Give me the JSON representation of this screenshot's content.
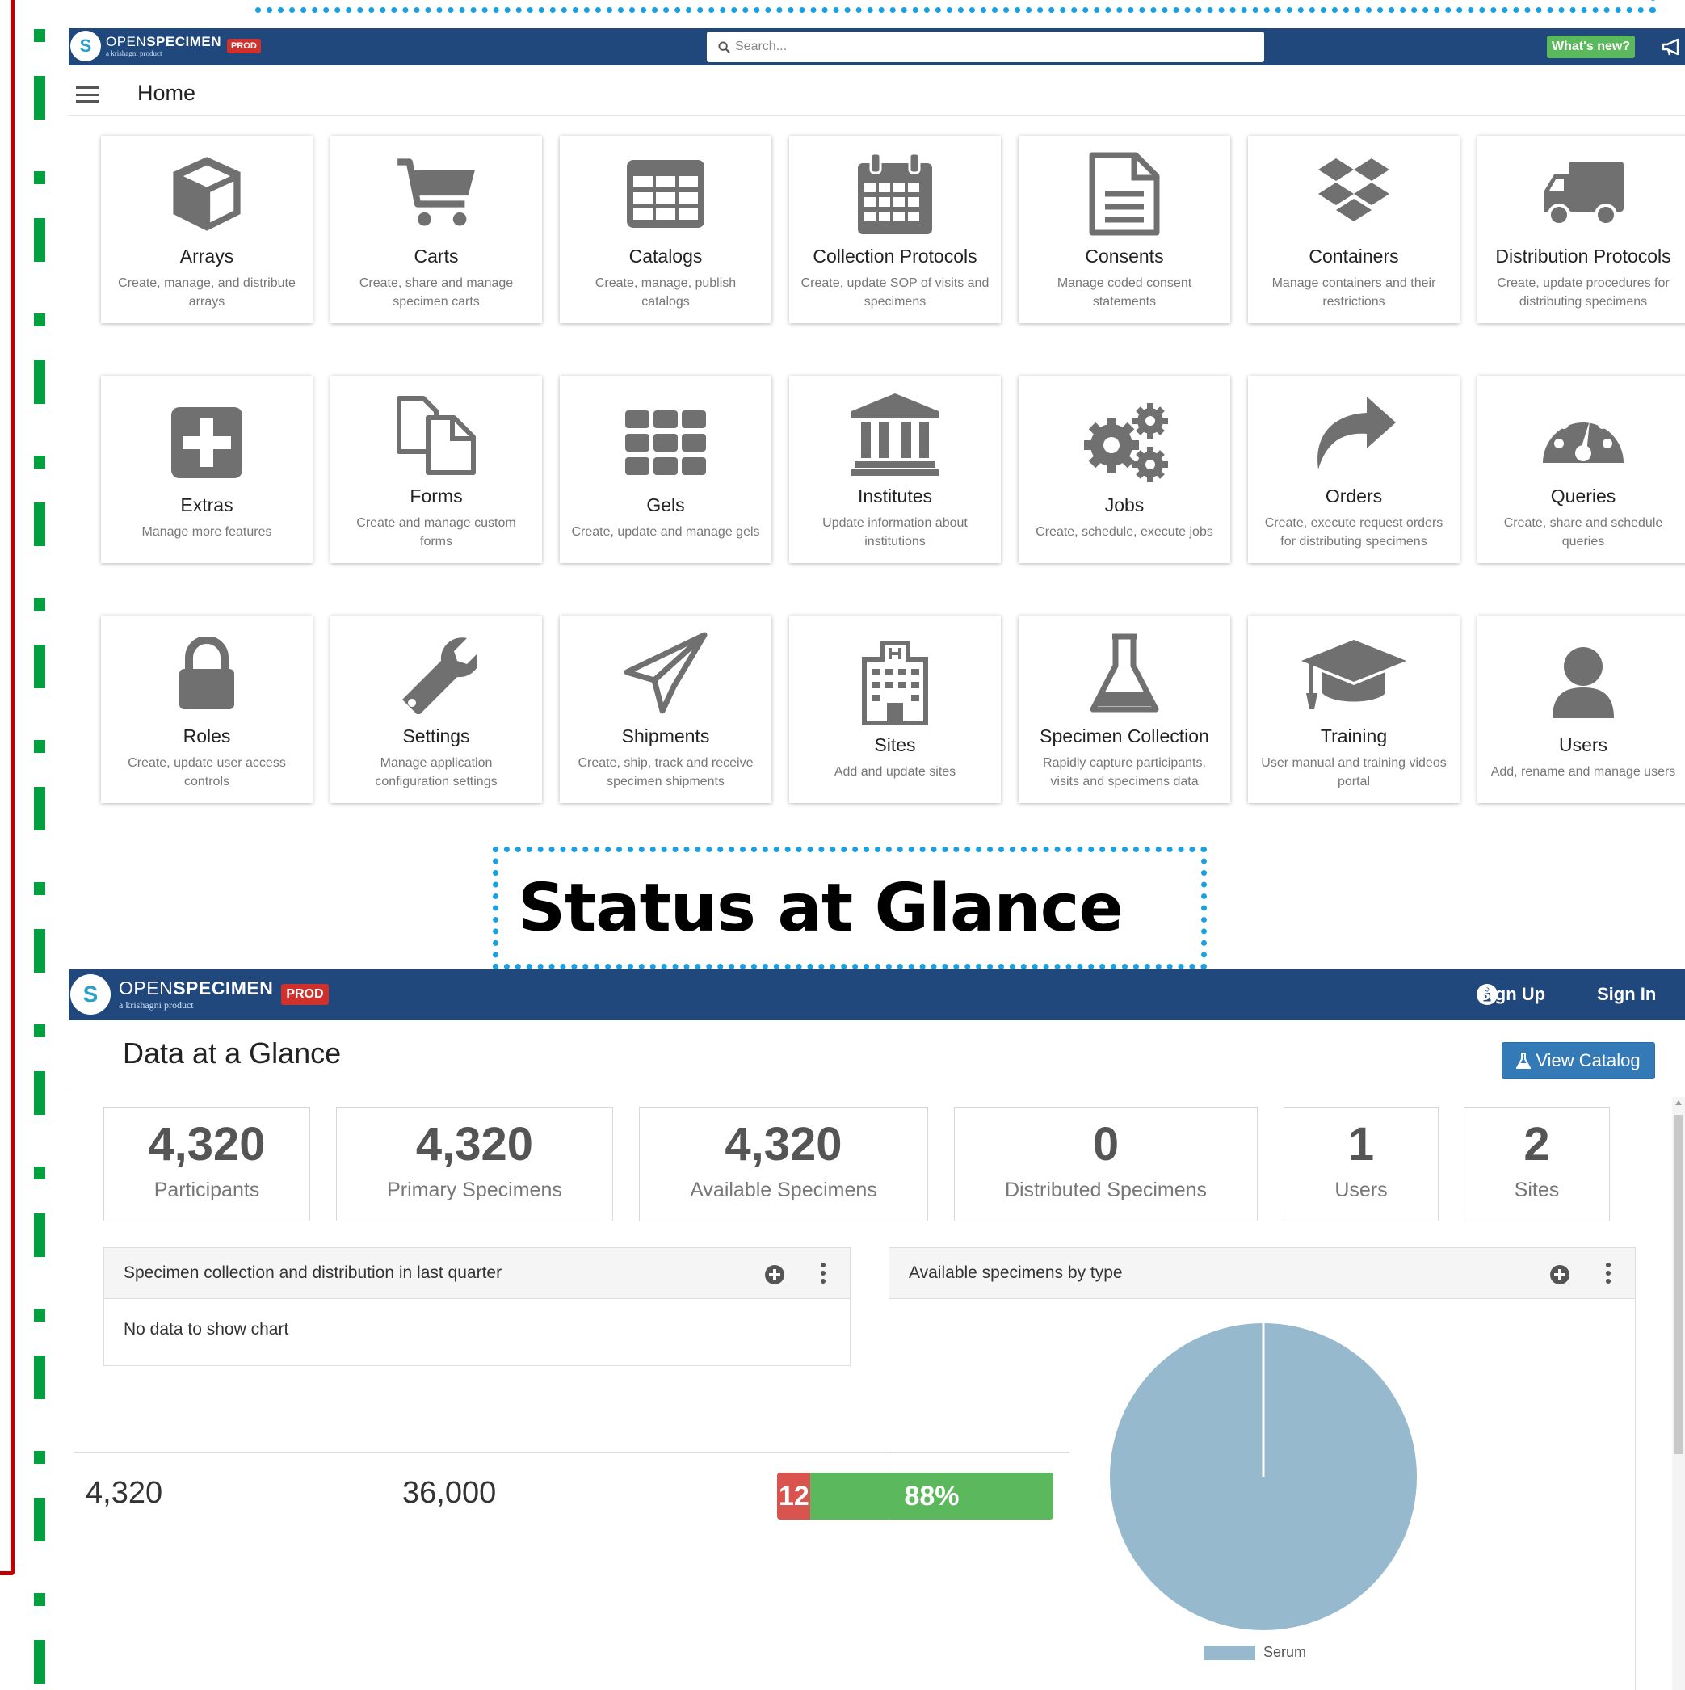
{
  "topbar": {
    "brand_open": "OPEN",
    "brand_specimen": "SPECIMEN",
    "brand_sub": "a krishagni product",
    "badge": "PROD",
    "search_placeholder": "Search...",
    "whats_new": "What's new?"
  },
  "header": {
    "title": "Home"
  },
  "tiles": [
    {
      "title": "Arrays",
      "desc": "Create, manage, and distribute arrays",
      "icon": "cube-icon"
    },
    {
      "title": "Carts",
      "desc": "Create, share and manage specimen carts",
      "icon": "cart-icon"
    },
    {
      "title": "Catalogs",
      "desc": "Create, manage, publish catalogs",
      "icon": "table-icon"
    },
    {
      "title": "Collection Protocols",
      "desc": "Create, update SOP of visits and specimens",
      "icon": "calendar-icon"
    },
    {
      "title": "Consents",
      "desc": "Manage coded consent statements",
      "icon": "document-icon"
    },
    {
      "title": "Containers",
      "desc": "Manage containers and their restrictions",
      "icon": "dropbox-icon"
    },
    {
      "title": "Distribution Protocols",
      "desc": "Create, update procedures for distributing specimens",
      "icon": "truck-icon"
    },
    {
      "title": "Extras",
      "desc": "Manage more features",
      "icon": "plus-square-icon"
    },
    {
      "title": "Forms",
      "desc": "Create and manage custom forms",
      "icon": "files-icon"
    },
    {
      "title": "Gels",
      "desc": "Create, update and manage gels",
      "icon": "grid-icon"
    },
    {
      "title": "Institutes",
      "desc": "Update information about institutions",
      "icon": "institution-icon"
    },
    {
      "title": "Jobs",
      "desc": "Create, schedule, execute jobs",
      "icon": "gears-icon"
    },
    {
      "title": "Orders",
      "desc": "Create, execute request orders for distributing specimens",
      "icon": "share-arrow-icon"
    },
    {
      "title": "Queries",
      "desc": "Create, share and schedule queries",
      "icon": "dashboard-icon"
    },
    {
      "title": "Roles",
      "desc": "Create, update user access controls",
      "icon": "lock-icon"
    },
    {
      "title": "Settings",
      "desc": "Manage application configuration settings",
      "icon": "wrench-icon"
    },
    {
      "title": "Shipments",
      "desc": "Create, ship, track and receive specimen shipments",
      "icon": "paper-plane-icon"
    },
    {
      "title": "Sites",
      "desc": "Add and update sites",
      "icon": "hospital-icon"
    },
    {
      "title": "Specimen Collection",
      "desc": "Rapidly capture participants, visits and specimens data",
      "icon": "flask-icon"
    },
    {
      "title": "Training",
      "desc": "User manual and training videos portal",
      "icon": "graduation-cap-icon"
    },
    {
      "title": "Users",
      "desc": "Add, rename and manage users",
      "icon": "user-icon"
    }
  ],
  "caption": "Status at Glance",
  "navbar2": {
    "sign_up": "Sign Up",
    "sign_in": "Sign In"
  },
  "glance": {
    "title": "Data at a Glance",
    "view_catalog": "View Catalog",
    "stats": [
      {
        "value": "4,320",
        "label": "Participants"
      },
      {
        "value": "4,320",
        "label": "Primary Specimens"
      },
      {
        "value": "4,320",
        "label": "Available Specimens"
      },
      {
        "value": "0",
        "label": "Distributed Specimens"
      },
      {
        "value": "1",
        "label": "Users"
      },
      {
        "value": "2",
        "label": "Sites"
      }
    ],
    "panel1": {
      "title": "Specimen collection and distribution in last quarter",
      "body": "No data to show chart"
    },
    "panel2": {
      "title": "Available specimens by type"
    }
  },
  "bottom": {
    "count": "4,320",
    "total": "36,000",
    "progress_red_label": "12",
    "progress_green_label": "88%",
    "progress_percent": 88
  },
  "chart_data": {
    "type": "pie",
    "labels": [
      "Serum"
    ],
    "values": [
      100
    ],
    "colors": [
      "#97b9ce"
    ],
    "legend": "bottom"
  }
}
